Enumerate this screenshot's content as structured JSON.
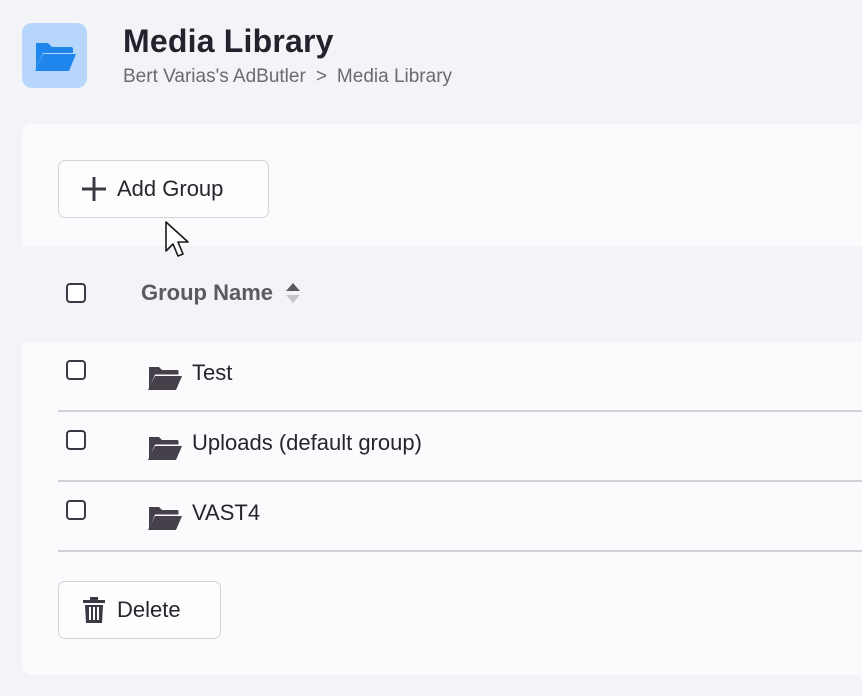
{
  "header": {
    "title": "Media Library",
    "breadcrumb": [
      "Bert Varias's AdButler",
      "Media Library"
    ],
    "breadcrumb_separator": ">",
    "icon": "folder-open-icon",
    "icon_color": "#1f86ee",
    "icon_bg": "#b6d7fb"
  },
  "toolbar": {
    "add_group_label": "Add Group",
    "add_group_icon": "plus-icon"
  },
  "table": {
    "columns": [
      {
        "label": "Group Name",
        "sortable": true
      }
    ],
    "rows": [
      {
        "name": "Test",
        "icon": "folder-open-icon",
        "checked": false
      },
      {
        "name": "Uploads (default group)",
        "icon": "folder-open-icon",
        "checked": false
      },
      {
        "name": "VAST4",
        "icon": "folder-open-icon",
        "checked": false
      }
    ]
  },
  "footer": {
    "delete_label": "Delete",
    "delete_icon": "trash-icon"
  }
}
